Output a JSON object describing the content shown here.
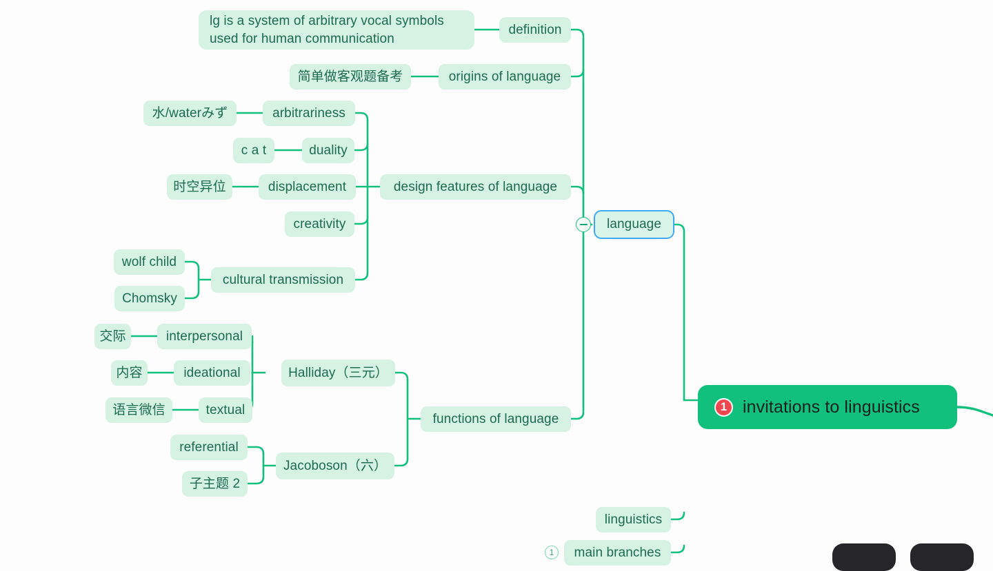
{
  "app": {
    "canvas_background": "#fdfdfd",
    "node_fill": "#d5f2e3",
    "node_text": "#1d6b50",
    "edge_color": "#12c07e",
    "root_fill": "#12c07e",
    "root_text": "#14201c",
    "badge_fill": "#f0474f",
    "selection_border": "#3fa9f5"
  },
  "root": {
    "label": "invitations to linguistics",
    "badge": "1"
  },
  "selected_node": {
    "label": "language",
    "collapse_state": "expanded",
    "toggle_icon": "minus-circle-icon"
  },
  "branches": [
    {
      "label": "definition",
      "children": [
        {
          "label": "lg is a system of arbitrary vocal symbols\nused for human communication"
        }
      ]
    },
    {
      "label": "origins of language",
      "children": [
        {
          "label": "简单做客观题备考"
        }
      ]
    },
    {
      "label": "design features of language",
      "children": [
        {
          "label": "arbitrariness",
          "children": [
            {
              "label": "水/waterみず"
            }
          ]
        },
        {
          "label": "duality",
          "children": [
            {
              "label": "c a t"
            }
          ]
        },
        {
          "label": "displacement",
          "children": [
            {
              "label": "时空异位"
            }
          ]
        },
        {
          "label": "creativity",
          "children": []
        },
        {
          "label": "cultural transmission",
          "children": [
            {
              "label": "wolf child"
            },
            {
              "label": "Chomsky"
            }
          ]
        }
      ]
    },
    {
      "label": "functions of language",
      "children": [
        {
          "label": "Halliday（三元）",
          "children": [
            {
              "label": "interpersonal",
              "children": [
                {
                  "label": "交际"
                }
              ]
            },
            {
              "label": "ideational",
              "children": [
                {
                  "label": "内容"
                }
              ]
            },
            {
              "label": "textual",
              "children": [
                {
                  "label": "语言微信"
                }
              ]
            }
          ]
        },
        {
          "label": "Jacoboson（六）",
          "children": [
            {
              "label": "referential"
            },
            {
              "label": "子主题 2"
            }
          ]
        }
      ]
    }
  ],
  "lower_nodes": [
    {
      "label": "linguistics"
    },
    {
      "label": "main branches",
      "badge": "1"
    }
  ],
  "bottom_toolbar": {
    "buttons": [
      {
        "name": "toolbar-button-left",
        "label": ""
      },
      {
        "name": "toolbar-button-right",
        "label": ""
      }
    ]
  }
}
